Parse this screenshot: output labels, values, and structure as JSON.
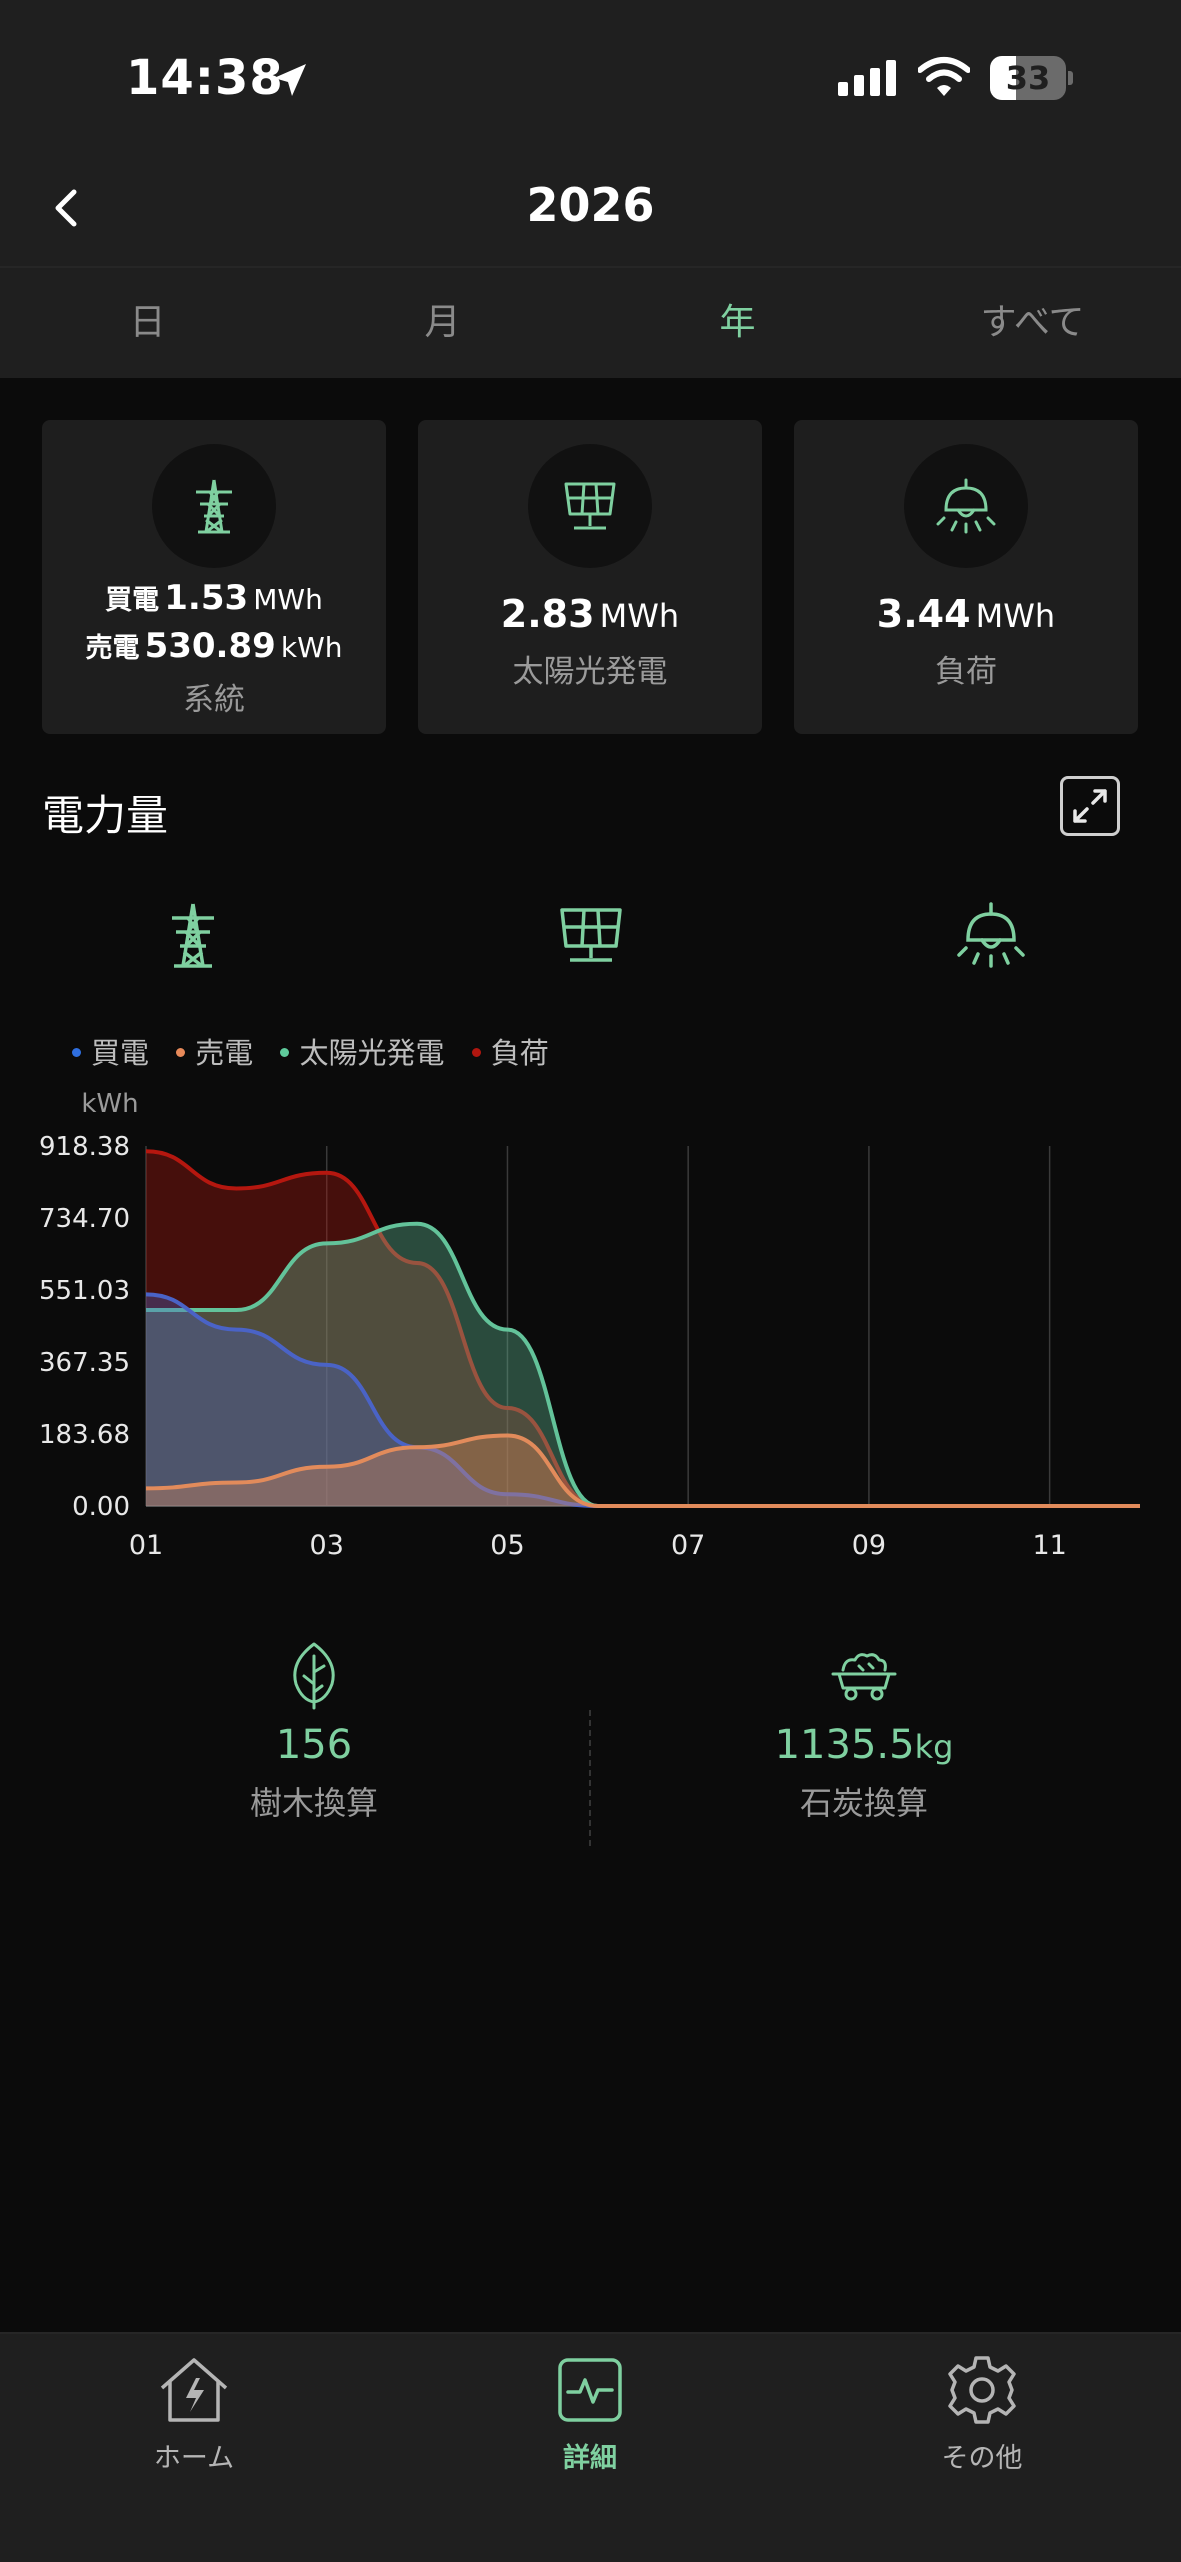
{
  "status_bar": {
    "time": "14:38",
    "battery": "33"
  },
  "nav": {
    "title": "2026"
  },
  "tabs": [
    {
      "label": "日"
    },
    {
      "label": "月"
    },
    {
      "label": "年"
    },
    {
      "label": "すべて"
    }
  ],
  "active_tab": "年",
  "cards": {
    "grid": {
      "buy_label": "買電",
      "buy_value": "1.53",
      "buy_unit": "MWh",
      "sell_label": "売電",
      "sell_value": "530.89",
      "sell_unit": "kWh",
      "caption": "系統"
    },
    "solar": {
      "value": "2.83",
      "unit": "MWh",
      "caption": "太陽光発電"
    },
    "load": {
      "value": "3.44",
      "unit": "MWh",
      "caption": "負荷"
    }
  },
  "section": {
    "title": "電力量"
  },
  "icons": [
    "transmission-tower-icon",
    "solar-panel-icon",
    "ceiling-lamp-icon",
    "leaf-icon",
    "coal-cart-icon",
    "home-bolt-icon",
    "activity-icon",
    "gear-icon"
  ],
  "chart_data": {
    "type": "area",
    "ylabel": "kWh",
    "y_ticks": [
      "918.38",
      "734.70",
      "551.03",
      "367.35",
      "183.68",
      "0.00"
    ],
    "ylim": [
      0,
      918.38
    ],
    "x_ticks": [
      "01",
      "03",
      "05",
      "07",
      "09",
      "11"
    ],
    "x": [
      1,
      2,
      3,
      4,
      5,
      6,
      7,
      8,
      9,
      10,
      11,
      12
    ],
    "series": [
      {
        "name": "負荷",
        "color": "#b5170f",
        "values": [
          905,
          810,
          850,
          620,
          250,
          0,
          0,
          0,
          0,
          0,
          0,
          0
        ]
      },
      {
        "name": "太陽光発電",
        "color": "#63c39a",
        "values": [
          500,
          500,
          670,
          720,
          450,
          0,
          0,
          0,
          0,
          0,
          0,
          0
        ]
      },
      {
        "name": "買電",
        "color": "#4a63c6",
        "values": [
          540,
          450,
          360,
          150,
          30,
          0,
          0,
          0,
          0,
          0,
          0,
          0
        ]
      },
      {
        "name": "売電",
        "color": "#e28b5b",
        "values": [
          45,
          60,
          100,
          150,
          180,
          0,
          0,
          0,
          0,
          0,
          0,
          0
        ]
      }
    ],
    "legend": [
      "買電",
      "売電",
      "太陽光発電",
      "負荷"
    ],
    "legend_colors": [
      "#2f6fe0",
      "#e88a5a",
      "#5fcb9c",
      "#b0160f"
    ],
    "grid": true,
    "legend_position": "top-left"
  },
  "summary": {
    "trees": {
      "value": "156",
      "label": "樹木換算"
    },
    "coal": {
      "value": "1135.5",
      "unit": "kg",
      "label": "石炭換算"
    }
  },
  "tabbar": [
    {
      "label": "ホーム"
    },
    {
      "label": "詳細"
    },
    {
      "label": "その他"
    }
  ],
  "colors": {
    "accent": "#7fd0a0",
    "background": "#0b0b0b",
    "card": "#1e1e1e"
  }
}
